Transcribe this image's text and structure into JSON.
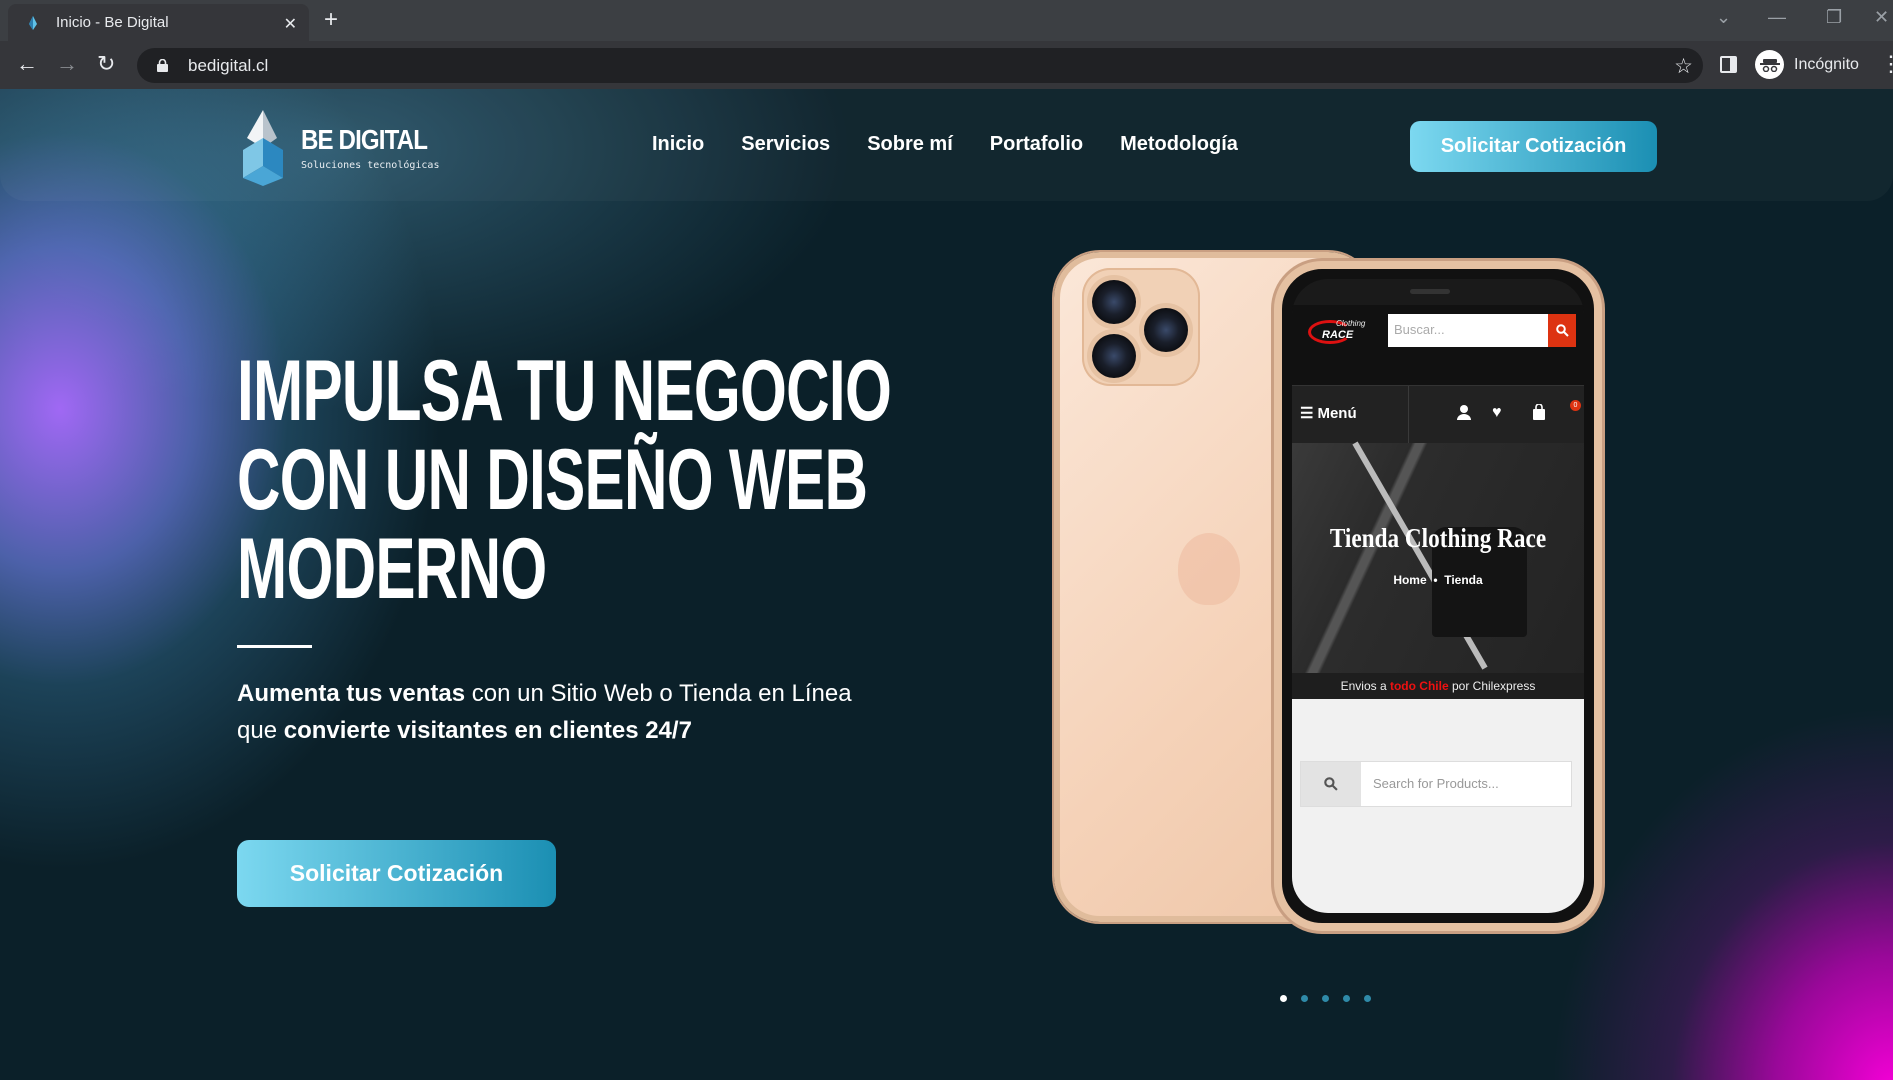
{
  "browser": {
    "tab_title": "Inicio - Be Digital",
    "url": "bedigital.cl",
    "profile_label": "Incógnito"
  },
  "site": {
    "logo_name": "BE DIGITAL",
    "logo_tagline": "Soluciones tecnológicas",
    "nav": [
      "Inicio",
      "Servicios",
      "Sobre mí",
      "Portafolio",
      "Metodología"
    ],
    "header_cta": "Solicitar Cotización"
  },
  "hero": {
    "title_lines": [
      "IMPULSA TU NEGOCIO",
      "CON UN DISEÑO WEB",
      "MODERNO"
    ],
    "subtitle_bold_1": "Aumenta tus ventas",
    "subtitle_text_1": " con un Sitio Web o Tienda en Línea",
    "subtitle_text_2": "que ",
    "subtitle_bold_2": " convierte visitantes en clientes 24/7",
    "cta": "Solicitar Cotización"
  },
  "mockup": {
    "logo_top": "Clothing",
    "logo_bottom": "RACE",
    "search_placeholder": "Buscar...",
    "menu_label": "Menú",
    "cart_count": "0",
    "page_title": "Tienda Clothing Race",
    "breadcrumb_home": "Home",
    "breadcrumb_sep": "•",
    "breadcrumb_current": "Tienda",
    "shipping_pre": "Envios a ",
    "shipping_highlight": "todo Chile",
    "shipping_post": " por Chilexpress",
    "product_search_placeholder": "Search for Products..."
  },
  "slider": {
    "count": 5,
    "active": 0
  },
  "colors": {
    "accent_start": "#7cd8f0",
    "accent_end": "#1b8fb3",
    "background": "#0b2029",
    "magenta": "#f500d7",
    "violet": "#a86cff"
  }
}
